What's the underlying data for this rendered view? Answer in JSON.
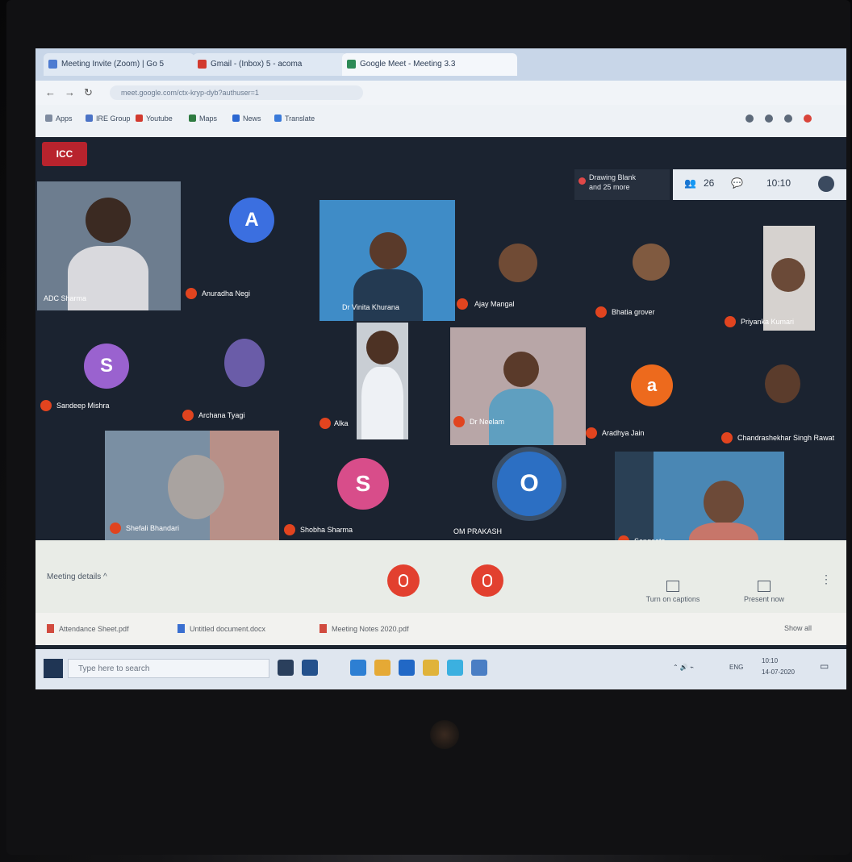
{
  "browser": {
    "tabs": [
      {
        "label": "Meeting Invite (Zoom) | Go 5"
      },
      {
        "label": "Gmail - (Inbox) 5 - acoma"
      },
      {
        "label": "Google Meet - Meeting 3.3"
      }
    ],
    "nav": {
      "back": "←",
      "forward": "→",
      "reload": "↻"
    },
    "url": "meet.google.com/ctx-kryp-dyb?authuser=1",
    "bookmarks": [
      {
        "label": "Apps",
        "color": "#7f8ca0"
      },
      {
        "label": "IRE Group",
        "color": "#4b73c6"
      },
      {
        "label": "Youtube",
        "color": "#d23a2f"
      },
      {
        "label": "Maps",
        "color": "#2e7b40"
      },
      {
        "label": "News",
        "color": "#2b67d1"
      },
      {
        "label": "Translate",
        "color": "#3a7ad9"
      }
    ]
  },
  "meeting": {
    "brand": "ICC",
    "presenting": {
      "line1": "Drawing Blank",
      "line2": "and 25 more"
    },
    "top_controls": {
      "people_count": "26",
      "chat_count": "",
      "time": "10:10"
    },
    "participants": [
      {
        "name": "ADC Sharma"
      },
      {
        "name": "Anuradha Negi",
        "initial": "A",
        "color": "#3b6fe0"
      },
      {
        "name": "Dr Vinita Khurana"
      },
      {
        "name": "Ajay Mangal"
      },
      {
        "name": "Bhatia grover"
      },
      {
        "name": "Priyanka Kumari"
      },
      {
        "name": "Sandeep Mishra",
        "initial": "S",
        "color": "#9a62cf"
      },
      {
        "name": "Archana Tyagi"
      },
      {
        "name": "Alka"
      },
      {
        "name": "Dr Neelam"
      },
      {
        "name": "Aradhya Jain",
        "initial": "a",
        "color": "#ed6a1d"
      },
      {
        "name": "Chandrashekhar Singh Rawat"
      },
      {
        "name": "Shefali Bhandari"
      },
      {
        "name": "Shobha Sharma",
        "initial": "S",
        "color": "#d84d8a"
      },
      {
        "name": "OM PRAKASH",
        "initial": "O",
        "color": "#2c6fc3"
      },
      {
        "name": "Sangeeta"
      }
    ]
  },
  "bottombar": {
    "meeting_details": "Meeting details",
    "chevron": "^",
    "turn_on_captions": "Turn on captions",
    "present_now": "Present now"
  },
  "downloads": [
    {
      "label": "Attendance Sheet.pdf"
    },
    {
      "label": "Untitled document.docx"
    },
    {
      "label": "Meeting Notes 2020.pdf"
    }
  ],
  "downloads_show_all": "Show all",
  "taskbar": {
    "search_placeholder": "Type here to search",
    "tray_text": "ENG",
    "clock_time": "10:10",
    "clock_date": "14-07-2020"
  }
}
